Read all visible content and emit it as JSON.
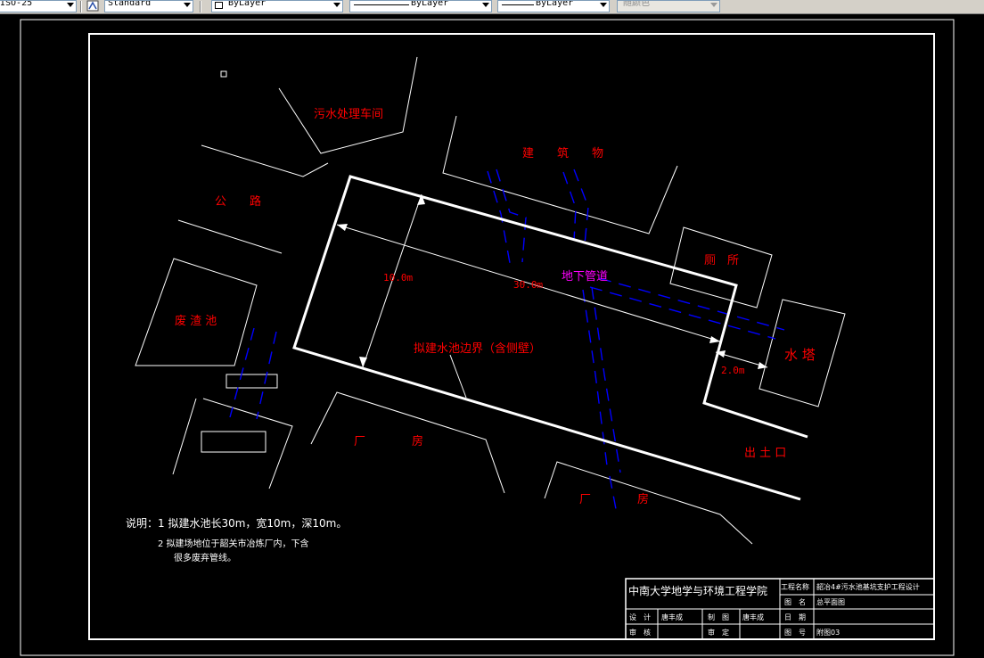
{
  "toolbar": {
    "dimstyle_value": "ISO-25",
    "textstyle_value": "Standard",
    "layer_value": "ByLayer",
    "linetype_value": "ByLayer",
    "lineweight_value": "ByLayer",
    "plotstyle_value": "随颜色"
  },
  "drawing": {
    "labels": {
      "sewage_workshop": "污水处理车间",
      "road": "公　　路",
      "building": "建　　筑　　物",
      "toilet": "厕　所",
      "slag_pool": "废 渣 池",
      "underground_pipe": "地下管道",
      "water_tower": "水 塔",
      "pool_boundary": "拟建水池边界（含侧壁）",
      "factory_1": "厂　　　　房",
      "factory_2": "厂　　　　房",
      "soil_exit": "出 土 口"
    },
    "dimensions": {
      "width": "10.0m",
      "length": "30.0m",
      "offset": "2.0m"
    },
    "notes": {
      "line1": "说明：1  拟建水池长30m，宽10m，深10m。",
      "line2": "2   拟建场地位于韶关市冶炼厂内，下含",
      "line3": "很多废弃管线。"
    },
    "title_block": {
      "institution": "中南大学地学与环境工程学院",
      "project_name_label": "工程名称",
      "project_name_value": "韶冶4#污水池基坑支护工程设计",
      "drawing_name_label": "图　名",
      "drawing_name_value": "总平面图",
      "design_label": "设　计",
      "design_value": "唐丰成",
      "draw_label": "制　图",
      "draw_value": "唐丰成",
      "date_label": "日　期",
      "date_value": "",
      "review_label": "审　核",
      "review_value": "",
      "approve_label": "审　定",
      "approve_value": "",
      "number_label": "图　号",
      "number_value": "附图03"
    },
    "colors": {
      "background": "#000000",
      "lines": "#ffffff",
      "labels": "#ff0000",
      "pipes": "#0000ff",
      "pipe_label": "#ff00ff"
    }
  }
}
